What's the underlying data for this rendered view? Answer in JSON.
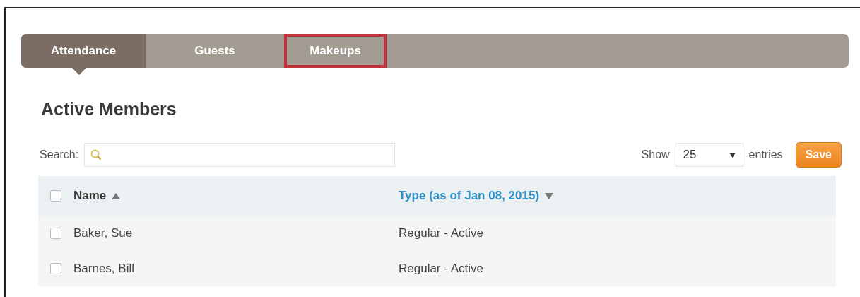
{
  "tabs": [
    {
      "label": "Attendance",
      "selected": true,
      "highlighted": false
    },
    {
      "label": "Guests",
      "selected": false,
      "highlighted": false
    },
    {
      "label": "Makeups",
      "selected": false,
      "highlighted": true
    }
  ],
  "heading": "Active Members",
  "search": {
    "label": "Search:"
  },
  "length": {
    "before": "Show",
    "value": "25",
    "after": "entries"
  },
  "save_button": "Save",
  "table": {
    "all_checked": false,
    "columns": [
      {
        "label": "Name",
        "sorted_ascending": true,
        "link": false
      },
      {
        "label": "Type (as of Jan 08, 2015)",
        "sorted_ascending": false,
        "link": true
      }
    ],
    "rows": [
      {
        "checked": false,
        "cells": [
          "Baker, Sue",
          "Regular - Active"
        ]
      },
      {
        "checked": false,
        "cells": [
          "Barnes, Bill",
          "Regular - Active"
        ]
      }
    ]
  }
}
